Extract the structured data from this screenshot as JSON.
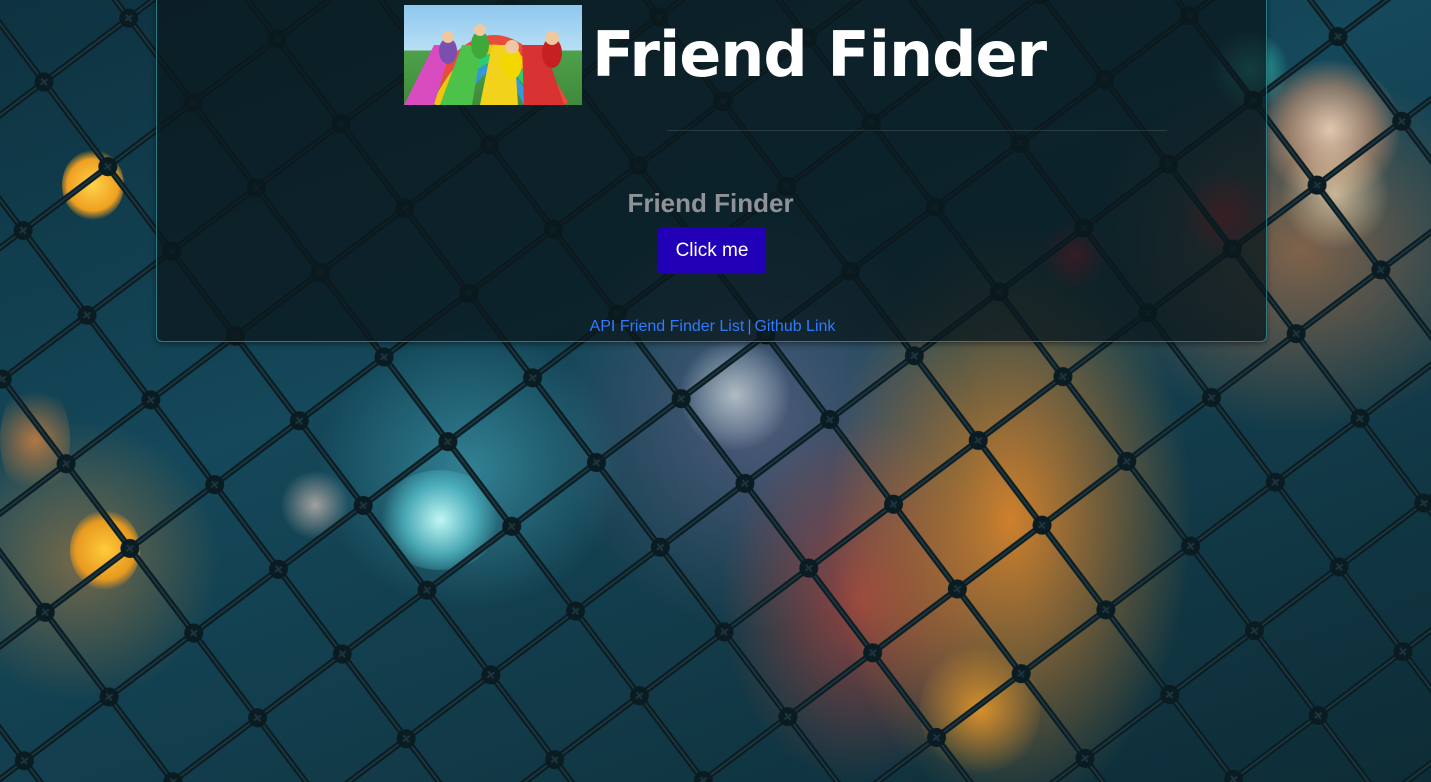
{
  "header": {
    "title": "Friend Finder",
    "logo_icon": "teletubbies-slide-image"
  },
  "main": {
    "subtitle": "Friend Finder",
    "cta_label": "Click me"
  },
  "footer": {
    "api_link": "API Friend Finder List",
    "separator": "|",
    "github_link": "Github Link"
  },
  "colors": {
    "button": "#2100b8",
    "link": "#2f7bff",
    "title": "#ffffff",
    "subtitle": "#8f9397"
  }
}
